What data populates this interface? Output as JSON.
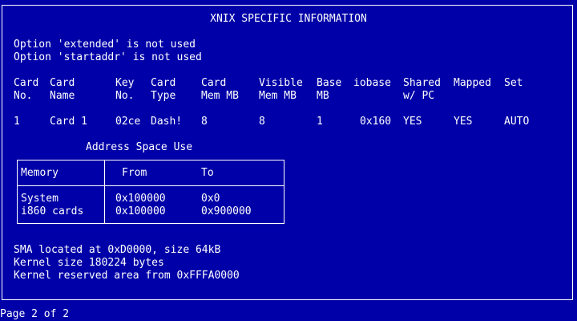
{
  "title": "XNIX SPECIFIC INFORMATION",
  "options": [
    "Option 'extended' is not used",
    "Option 'startaddr' is not used"
  ],
  "card_table": {
    "headers": [
      [
        "Card",
        "No."
      ],
      [
        "Card",
        "Name"
      ],
      [
        "Key",
        "No."
      ],
      [
        "Card",
        "Type"
      ],
      [
        "Card",
        "Mem MB"
      ],
      [
        "Visible",
        "Mem MB"
      ],
      [
        "Base",
        "MB"
      ],
      [
        "iobase",
        ""
      ],
      [
        "Shared",
        "w/ PC"
      ],
      [
        "Mapped",
        ""
      ],
      [
        "Set",
        ""
      ]
    ],
    "rows": [
      [
        "1",
        "Card 1",
        "02ce",
        "Dash!",
        "8",
        "8",
        "1",
        "0x160",
        "YES",
        "YES",
        "AUTO"
      ]
    ]
  },
  "address_space": {
    "caption": "Address Space Use",
    "headers": [
      "Memory",
      "From",
      "To"
    ],
    "rows": [
      [
        "System",
        "0x100000",
        "0x0"
      ],
      [
        "i860 cards",
        "0x100000",
        "0x900000"
      ]
    ]
  },
  "info_lines": [
    "SMA located at 0xD0000, size 64kB",
    "Kernel size 180224 bytes",
    "Kernel reserved area from 0xFFFA0000"
  ],
  "page_indicator": "Page 2 of 2",
  "colors": {
    "background": "#0000a8",
    "foreground": "#ffffff"
  }
}
